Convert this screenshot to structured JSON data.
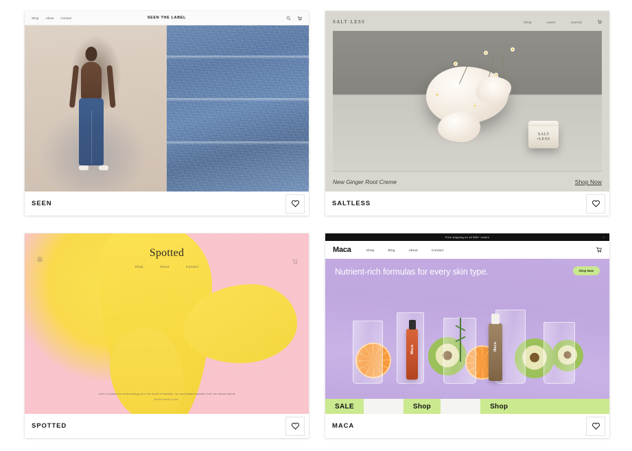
{
  "gallery": {
    "cards": [
      {
        "id": "seen",
        "label": "SEEN",
        "favorite_icon": "heart-icon",
        "preview": {
          "brand": "SEEN THE LABEL",
          "nav": [
            "Shop",
            "About",
            "Contact"
          ],
          "icons": [
            "search-icon",
            "cart-icon"
          ]
        }
      },
      {
        "id": "saltless",
        "label": "SALTLESS",
        "favorite_icon": "heart-icon",
        "preview": {
          "brand": "SALT·LESS",
          "nav": [
            "Shop",
            "Learn",
            "Journal"
          ],
          "icons": [
            "cart-icon"
          ],
          "jar_label_line1": "SALT",
          "jar_label_line2": "•LESS",
          "footer_caption": "New Ginger Root Creme",
          "footer_link": "Shop Now"
        }
      },
      {
        "id": "spotted",
        "label": "SPOTTED",
        "favorite_icon": "heart-icon",
        "preview": {
          "brand": "Spotted",
          "nav": [
            "Shop",
            "About",
            "Contact"
          ],
          "icons": [
            "menu-icon",
            "cart-icon"
          ],
          "body_copy": "Leila is a watercolor artist working out of her studio in Brooklyn, her work draws inspiration from the natural objects",
          "signature": "and the beauty of color."
        }
      },
      {
        "id": "maca",
        "label": "MACA",
        "favorite_icon": "heart-icon",
        "preview": {
          "banner": "Free shipping on all $30+ orders",
          "banner_close": "×",
          "brand": "Maca",
          "nav": [
            "Shop",
            "Blog",
            "About",
            "Contact"
          ],
          "icons": [
            "cart-icon"
          ],
          "headline": "Nutrient-rich formulas for every skin type.",
          "cta": "Shop Now",
          "bottle_a_label": "Maca",
          "bottle_b_label": "Maca",
          "marquee": [
            "SALE",
            "Shop",
            "Shop"
          ]
        }
      }
    ]
  },
  "colors": {
    "page_background": "#ffffff",
    "card_background": "#ffffff",
    "seen_denim": "#4d6f9f",
    "saltless_bg": "#d9d7cf",
    "spotted_pink": "#f9c4cc",
    "spotted_yellow": "#f9d94a",
    "maca_purple": "#c3abe2",
    "maca_green": "#cbe98f",
    "maca_black": "#121212"
  }
}
